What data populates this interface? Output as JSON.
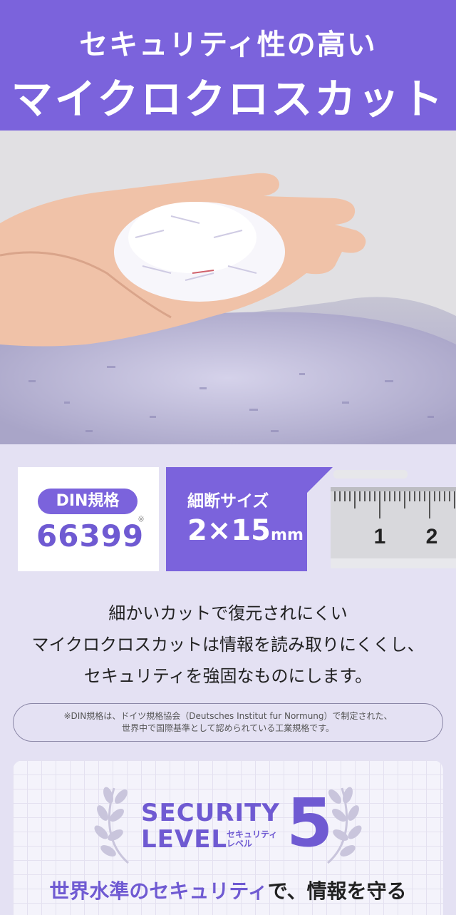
{
  "header": {
    "line1": "セキュリティ性の高い",
    "line2": "マイクロクロスカット"
  },
  "spec": {
    "din_label": "DIN規格",
    "din_number": "66399",
    "din_mark": "※",
    "size_label": "細断サイズ",
    "size_value": "2×15",
    "size_unit": "mm",
    "ruler_labels": [
      "1",
      "2"
    ]
  },
  "description": {
    "line1": "細かいカットで復元されにくい",
    "line2": "マイクロクロスカットは情報を読み取りにくくし、",
    "line3": "セキュリティを強固なものにします。"
  },
  "note": {
    "line1": "※DIN規格は、ドイツ規格協会（Deutsches Institut fur Normung）で制定された、",
    "line2": "世界中で国際基準として認められている工業規格です。"
  },
  "security": {
    "word1": "SECURITY",
    "word2": "LEVEL",
    "kana1": "セキュリティ",
    "kana2": "レベル",
    "level": "5",
    "tagline_accent": "世界水準のセキュリティ",
    "tagline_rest": "で、情報を守る"
  },
  "colors": {
    "accent": "#7b63dc",
    "background": "#e4e1f3"
  }
}
